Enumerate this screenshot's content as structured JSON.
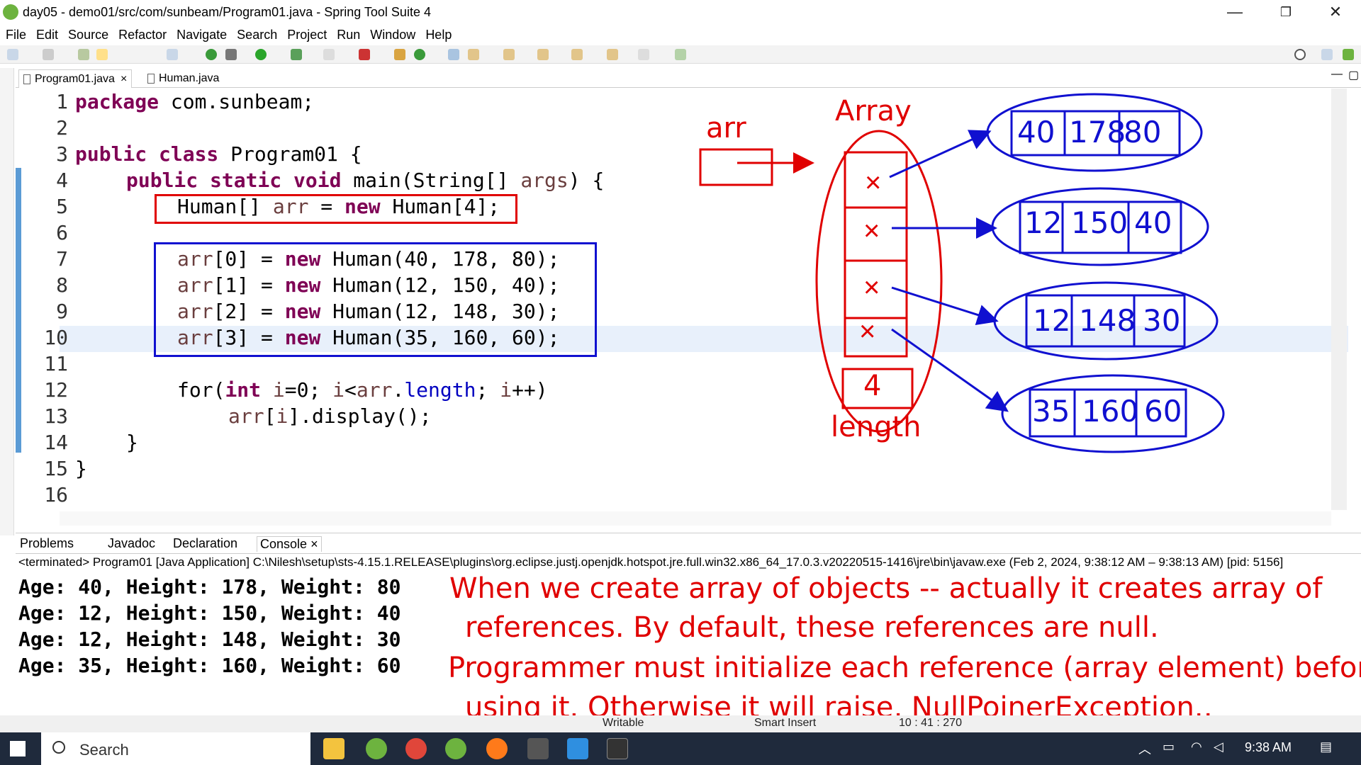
{
  "window": {
    "title": "day05 - demo01/src/com/sunbeam/Program01.java - Spring Tool Suite 4",
    "min": "—",
    "max": "❐",
    "close": "✕"
  },
  "menu": [
    "File",
    "Edit",
    "Source",
    "Refactor",
    "Navigate",
    "Search",
    "Project",
    "Run",
    "Window",
    "Help"
  ],
  "editor_tabs": [
    {
      "label": "Program01.java",
      "close": "×"
    },
    {
      "label": "Human.java"
    }
  ],
  "code": {
    "line_numbers": [
      "1",
      "2",
      "3",
      "4",
      "5",
      "6",
      "7",
      "8",
      "9",
      "10",
      "11",
      "12",
      "13",
      "14",
      "15",
      "16"
    ],
    "l1_kw": "package",
    "l1_rest": " com.sunbeam;",
    "l3_kw": "public class",
    "l3_rest": " Program01 {",
    "l4_kw": "public static void",
    "l4_rest": " main(String[] ",
    "l4_var": "args",
    "l4_end": ") {",
    "l5_a": "Human[] ",
    "l5_var": "arr",
    "l5_b": " = ",
    "l5_kw": "new",
    "l5_c": " Human[4];",
    "l7_var": "arr",
    "l7_a": "[0] = ",
    "l7_kw": "new",
    "l7_b": " Human(40, 178, 80);",
    "l8_var": "arr",
    "l8_a": "[1] = ",
    "l8_kw": "new",
    "l8_b": " Human(12, 150, 40);",
    "l9_var": "arr",
    "l9_a": "[2] = ",
    "l9_kw": "new",
    "l9_b": " Human(12, 148, 30);",
    "l10_var": "arr",
    "l10_a": "[3] = ",
    "l10_kw": "new",
    "l10_b": " Human(35, 160, 60);",
    "l12_a": "for(",
    "l12_kw": "int",
    "l12_b": " ",
    "l12_var1": "i",
    "l12_c": "=0; ",
    "l12_var2": "i",
    "l12_d": "<",
    "l12_var3": "arr",
    "l12_e": ".",
    "l12_fld": "length",
    "l12_f": "; ",
    "l12_var4": "i",
    "l12_g": "++)",
    "l13_var": "arr",
    "l13_a": "[",
    "l13_var2": "i",
    "l13_b": "].display();",
    "l14": "}",
    "l15": "}"
  },
  "annotations": {
    "arr_label": "arr",
    "array_label": "Array",
    "length_label": "length",
    "length_value": "4",
    "cross": "×",
    "objects": [
      [
        "40",
        "178",
        "80"
      ],
      [
        "12",
        "150",
        "40"
      ],
      [
        "12",
        "148",
        "30"
      ],
      [
        "35",
        "160",
        "60"
      ]
    ]
  },
  "console_tabs": [
    "Problems",
    "Javadoc",
    "Declaration",
    "Console"
  ],
  "console_close": "×",
  "console": {
    "path": "<terminated> Program01 [Java Application] C:\\Nilesh\\setup\\sts-4.15.1.RELEASE\\plugins\\org.eclipse.justj.openjdk.hotspot.jre.full.win32.x86_64_17.0.3.v20220515-1416\\jre\\bin\\javaw.exe  (Feb 2, 2024, 9:38:12 AM – 9:38:13 AM) [pid: 5156]",
    "output": [
      "Age: 40, Height: 178, Weight: 80",
      "Age: 12, Height: 150, Weight: 40",
      "Age: 12, Height: 148, Weight: 30",
      "Age: 35, Height: 160, Weight: 60"
    ]
  },
  "note": [
    "When we create array of objects -- actually it creates array of",
    "references. By default, these references are null.",
    "Programmer must initialize each reference (array element) before",
    "using it. Otherwise it will raise, NullPoinerException.,"
  ],
  "status": {
    "writable": "Writable",
    "insert": "Smart Insert",
    "pos": "10 : 41 : 270"
  },
  "taskbar": {
    "search": "Search",
    "time": "9:38 AM"
  }
}
